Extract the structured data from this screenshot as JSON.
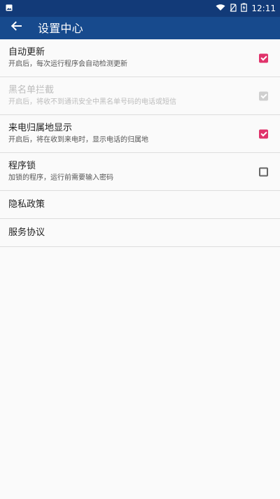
{
  "status_bar": {
    "time": "12:11",
    "left_icon": "image-icon",
    "right_icons": [
      "wifi-icon",
      "no-sim-icon",
      "battery-charging-icon"
    ]
  },
  "app_bar": {
    "title": "设置中心",
    "back_icon": "back-arrow-icon"
  },
  "colors": {
    "status_bar": "#123a78",
    "app_bar": "#174a8d",
    "accent": "#e0336b",
    "background": "#fafafa",
    "divider": "#dddddd"
  },
  "settings": [
    {
      "title": "自动更新",
      "subtitle": "开启后，每次运行程序会自动检测更新",
      "checked": true,
      "enabled": true
    },
    {
      "title": "黑名单拦截",
      "subtitle": "开启后，将收不到通讯安全中黑名单号码的电话或短信",
      "checked": true,
      "enabled": false
    },
    {
      "title": "来电归属地显示",
      "subtitle": "开启后，将在收到来电时，显示电话的归属地",
      "checked": true,
      "enabled": true
    },
    {
      "title": "程序锁",
      "subtitle": "加锁的程序，运行前需要输入密码",
      "checked": false,
      "enabled": true
    }
  ],
  "links": [
    {
      "title": "隐私政策"
    },
    {
      "title": "服务协议"
    }
  ]
}
